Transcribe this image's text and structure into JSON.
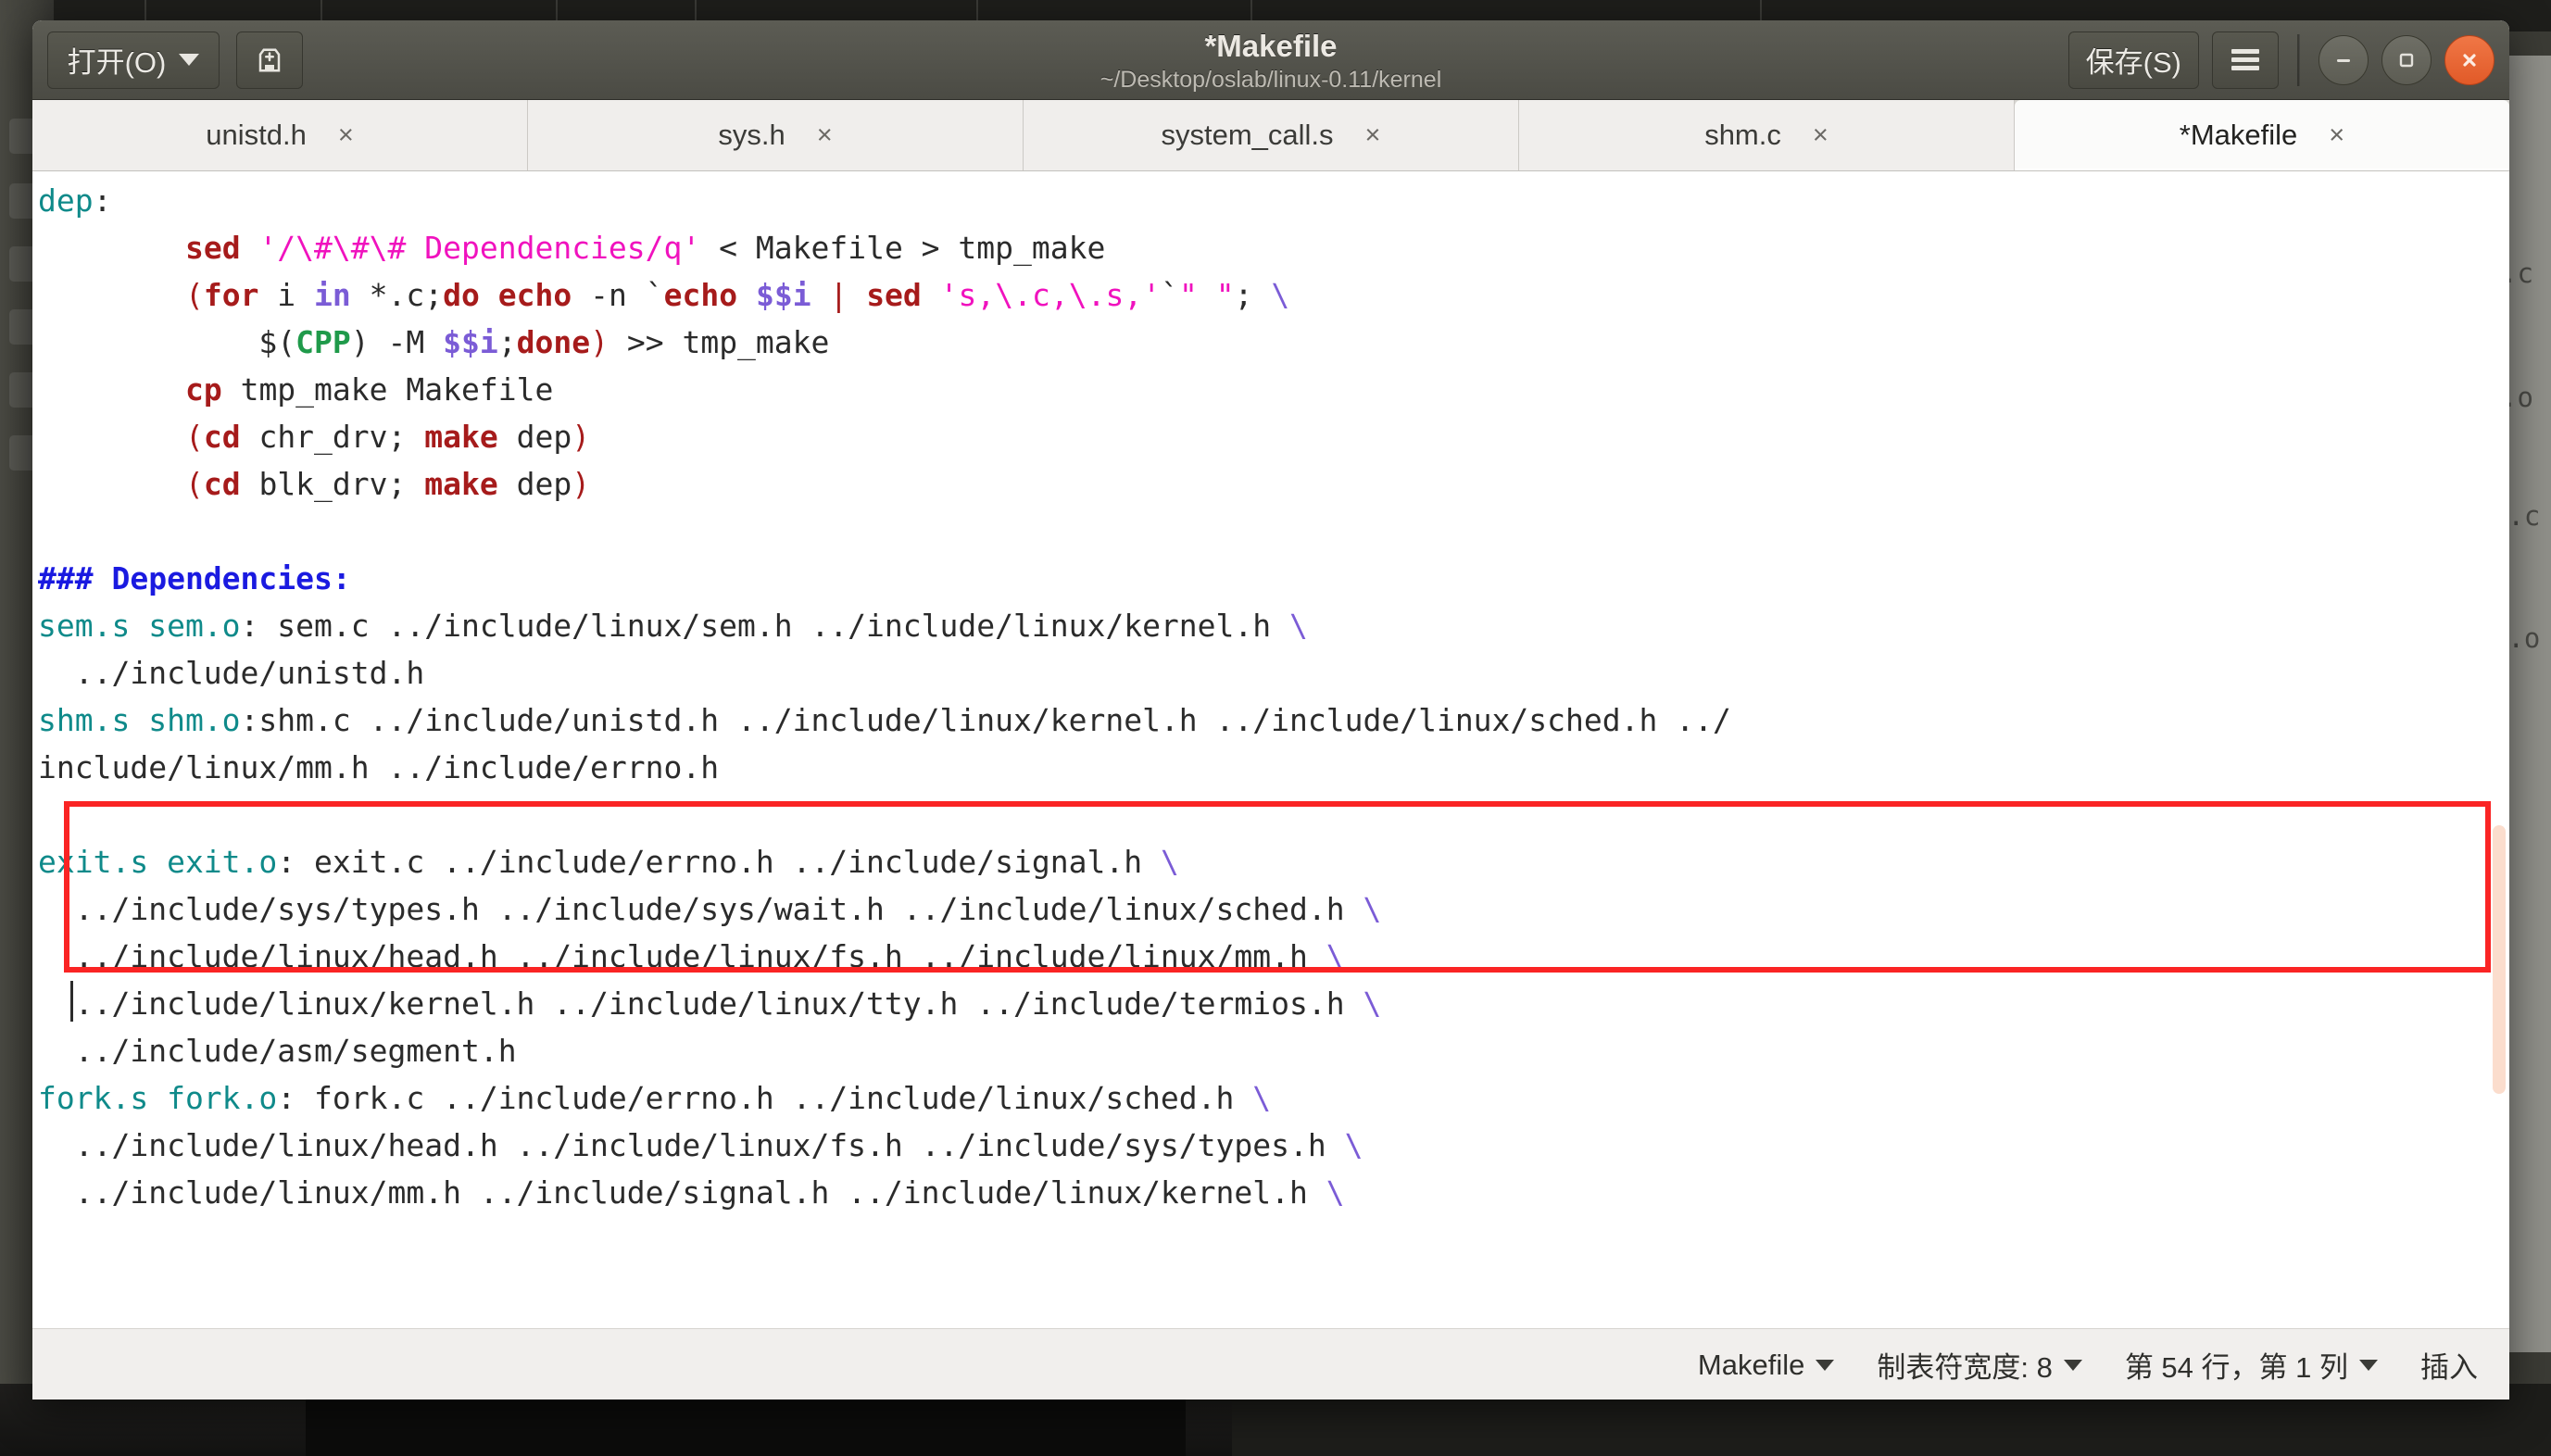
{
  "window": {
    "title": "*Makefile",
    "subtitle": "~/Desktop/oslab/linux-0.11/kernel",
    "open_button": "打开(O)",
    "save_button": "保存(S)",
    "new_file_icon": "save-disk-icon",
    "menu_icon": "hamburger-menu-icon",
    "minimize_icon": "minimize-icon",
    "maximize_icon": "maximize-icon",
    "close_icon": "close-icon",
    "dropdown_icon": "chevron-down-icon"
  },
  "tabs": [
    {
      "label": "unistd.h",
      "close": "×",
      "active": false
    },
    {
      "label": "sys.h",
      "close": "×",
      "active": false
    },
    {
      "label": "system_call.s",
      "close": "×",
      "active": false
    },
    {
      "label": "shm.c",
      "close": "×",
      "active": false
    },
    {
      "label": "*Makefile",
      "close": "×",
      "active": true
    }
  ],
  "editor": {
    "lines": [
      [
        {
          "t": "dep",
          "c": "tgt"
        },
        {
          "t": ":",
          "c": "plain"
        }
      ],
      [
        {
          "t": "        ",
          "c": "plain"
        },
        {
          "t": "sed",
          "c": "kw"
        },
        {
          "t": " ",
          "c": "plain"
        },
        {
          "t": "'/\\#\\#\\# Dependencies/q'",
          "c": "str"
        },
        {
          "t": " < Makefile > tmp_make",
          "c": "plain"
        }
      ],
      [
        {
          "t": "        ",
          "c": "plain"
        },
        {
          "t": "(",
          "c": "punc"
        },
        {
          "t": "for",
          "c": "kw"
        },
        {
          "t": " i ",
          "c": "plain"
        },
        {
          "t": "in",
          "c": "var"
        },
        {
          "t": " *.c;",
          "c": "plain"
        },
        {
          "t": "do",
          "c": "kw"
        },
        {
          "t": " ",
          "c": "plain"
        },
        {
          "t": "echo",
          "c": "kw"
        },
        {
          "t": " -n `",
          "c": "plain"
        },
        {
          "t": "echo",
          "c": "kw"
        },
        {
          "t": " ",
          "c": "plain"
        },
        {
          "t": "$$i",
          "c": "var"
        },
        {
          "t": " ",
          "c": "plain"
        },
        {
          "t": "|",
          "c": "punc"
        },
        {
          "t": " ",
          "c": "plain"
        },
        {
          "t": "sed",
          "c": "kw"
        },
        {
          "t": " ",
          "c": "plain"
        },
        {
          "t": "'s,\\.c,\\.s,'",
          "c": "str"
        },
        {
          "t": "`",
          "c": "plain"
        },
        {
          "t": "\" \"",
          "c": "str"
        },
        {
          "t": "; ",
          "c": "plain"
        },
        {
          "t": "\\",
          "c": "cont"
        }
      ],
      [
        {
          "t": "            ",
          "c": "plain"
        },
        {
          "t": "$(",
          "c": "plain"
        },
        {
          "t": "CPP",
          "c": "fn"
        },
        {
          "t": ")",
          "c": "plain"
        },
        {
          "t": " -M ",
          "c": "plain"
        },
        {
          "t": "$$i",
          "c": "var"
        },
        {
          "t": ";",
          "c": "plain"
        },
        {
          "t": "done",
          "c": "kw"
        },
        {
          "t": ")",
          "c": "punc"
        },
        {
          "t": " >> tmp_make",
          "c": "plain"
        }
      ],
      [
        {
          "t": "        ",
          "c": "plain"
        },
        {
          "t": "cp",
          "c": "kw"
        },
        {
          "t": " tmp_make Makefile",
          "c": "plain"
        }
      ],
      [
        {
          "t": "        ",
          "c": "plain"
        },
        {
          "t": "(",
          "c": "punc"
        },
        {
          "t": "cd",
          "c": "kw"
        },
        {
          "t": " chr_drv; ",
          "c": "plain"
        },
        {
          "t": "make",
          "c": "kw"
        },
        {
          "t": " dep",
          "c": "plain"
        },
        {
          "t": ")",
          "c": "punc"
        }
      ],
      [
        {
          "t": "        ",
          "c": "plain"
        },
        {
          "t": "(",
          "c": "punc"
        },
        {
          "t": "cd",
          "c": "kw"
        },
        {
          "t": " blk_drv; ",
          "c": "plain"
        },
        {
          "t": "make",
          "c": "kw"
        },
        {
          "t": " dep",
          "c": "plain"
        },
        {
          "t": ")",
          "c": "punc"
        }
      ],
      [],
      [
        {
          "t": "### Dependencies:",
          "c": "cmt"
        }
      ],
      [
        {
          "t": "sem.s sem.o",
          "c": "tgt"
        },
        {
          "t": ": sem.c ../include/linux/sem.h ../include/linux/kernel.h ",
          "c": "plain"
        },
        {
          "t": "\\",
          "c": "cont"
        }
      ],
      [
        {
          "t": "  ../include/unistd.h",
          "c": "plain"
        }
      ],
      [
        {
          "t": "shm.s shm.o",
          "c": "tgt"
        },
        {
          "t": ":shm.c ../include/unistd.h ../include/linux/kernel.h ../include/linux/sched.h ../",
          "c": "plain"
        }
      ],
      [
        {
          "t": "include/linux/mm.h ../include/errno.h",
          "c": "plain"
        }
      ],
      [],
      [
        {
          "t": "exit.s exit.o",
          "c": "tgt"
        },
        {
          "t": ": exit.c ../include/errno.h ../include/signal.h ",
          "c": "plain"
        },
        {
          "t": "\\",
          "c": "cont"
        }
      ],
      [
        {
          "t": "  ../include/sys/types.h ../include/sys/wait.h ../include/linux/sched.h ",
          "c": "plain"
        },
        {
          "t": "\\",
          "c": "cont"
        }
      ],
      [
        {
          "t": "  ../include/linux/head.h ../include/linux/fs.h ../include/linux/mm.h ",
          "c": "plain"
        },
        {
          "t": "\\",
          "c": "cont"
        }
      ],
      [
        {
          "t": "  ../include/linux/kernel.h ../include/linux/tty.h ../include/termios.h ",
          "c": "plain"
        },
        {
          "t": "\\",
          "c": "cont"
        }
      ],
      [
        {
          "t": "  ../include/asm/segment.h",
          "c": "plain"
        }
      ],
      [
        {
          "t": "fork.s fork.o",
          "c": "tgt"
        },
        {
          "t": ": fork.c ../include/errno.h ../include/linux/sched.h ",
          "c": "plain"
        },
        {
          "t": "\\",
          "c": "cont"
        }
      ],
      [
        {
          "t": "  ../include/linux/head.h ../include/linux/fs.h ../include/sys/types.h ",
          "c": "plain"
        },
        {
          "t": "\\",
          "c": "cont"
        }
      ],
      [
        {
          "t": "  ../include/linux/mm.h ../include/signal.h ../include/linux/kernel.h ",
          "c": "plain"
        },
        {
          "t": "\\",
          "c": "cont"
        }
      ]
    ]
  },
  "annotation": {
    "highlight_color": "#fa2424"
  },
  "statusbar": {
    "language": "Makefile",
    "tab_width": "制表符宽度: 8",
    "position": "第 54 行，第 1 列",
    "insert_mode": "插入"
  },
  "background": {
    "window_text": [
      ".c",
      ".o",
      "f.c",
      "f.o",
      ".o"
    ]
  }
}
